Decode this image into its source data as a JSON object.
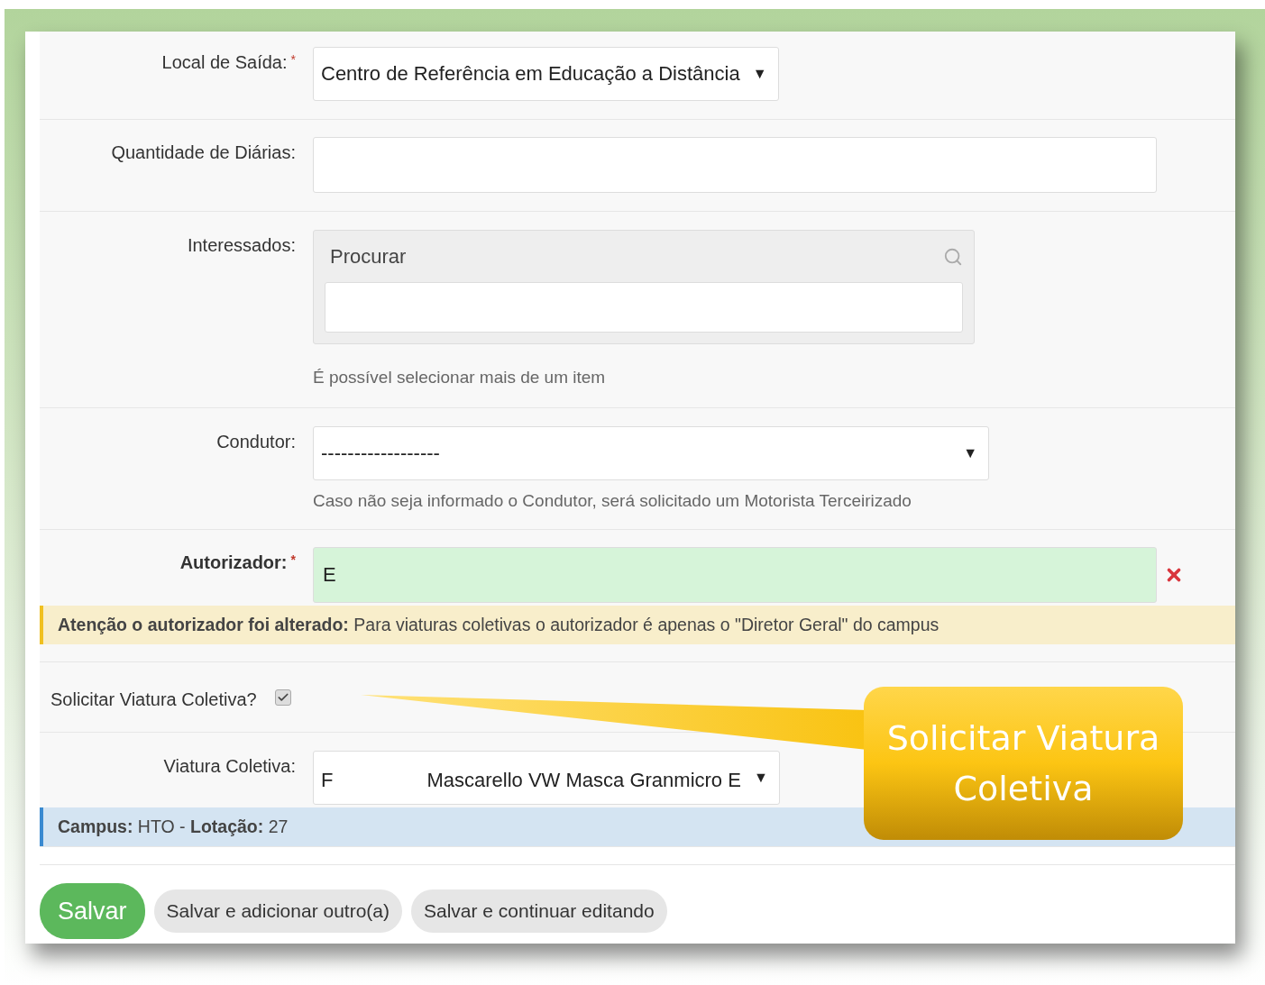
{
  "fields": [
    {
      "kind": "select",
      "label": "Local de Saída:",
      "required_mark": "*",
      "value": "Centro de Referência em Educação a Distância",
      "arrow": "▼"
    },
    {
      "kind": "text",
      "label": "Quantidade de Diárias:"
    },
    {
      "kind": "multiselect",
      "label": "Interessados:",
      "search_placeholder": "Procurar",
      "help": "É possível selecionar mais de um item"
    },
    {
      "kind": "select",
      "label": "Condutor:",
      "value": "------------------",
      "arrow": "▼",
      "wide": true,
      "help": "Caso não seja informado o Condutor, será solicitado um Motorista Terceirizado"
    },
    {
      "kind": "autocomplete",
      "label": "Autorizador:",
      "required_mark": "*",
      "value": "E",
      "valid": true,
      "alert": {
        "kind": "warning",
        "text": "**Atenção o autorizador foi alterado:** Para viaturas coletivas o autorizador é apenas o \"Diretor Geral\" do campus"
      }
    },
    {
      "kind": "checkbox",
      "label": "Solicitar Viatura Coletiva?",
      "checked": true
    },
    {
      "kind": "select",
      "label": "Viatura Coletiva:",
      "value_prefix": "F",
      "value": "Mascarello VW Masca Granmicro E",
      "arrow": "▼",
      "alert": {
        "kind": "info",
        "text": "**Campus:** HTO - **Lotação:** 27"
      }
    }
  ],
  "buttons": [
    {
      "label": "Salvar",
      "kind": "primary"
    },
    {
      "label": "Salvar e adicionar outro(a)",
      "kind": "default"
    },
    {
      "label": "Salvar e continuar editando",
      "kind": "default"
    }
  ],
  "callout": {
    "text": "Solicitar Viatura Coletiva"
  }
}
